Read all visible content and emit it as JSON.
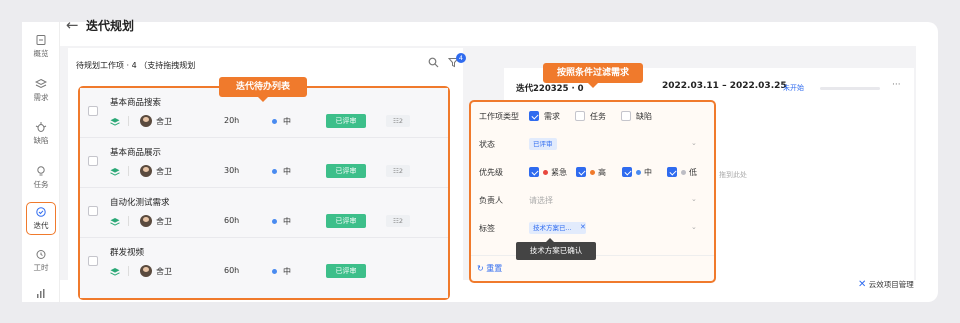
{
  "sidebar": {
    "items": [
      {
        "label": "概览",
        "icon": "overview-icon"
      },
      {
        "label": "需求",
        "icon": "layers-icon"
      },
      {
        "label": "缺陷",
        "icon": "bug-icon"
      },
      {
        "label": "任务",
        "icon": "bulb-icon"
      },
      {
        "label": "迭代",
        "icon": "iteration-icon",
        "active": true
      },
      {
        "label": "工时",
        "icon": "clock-icon"
      }
    ]
  },
  "header": {
    "back_icon": "←",
    "title": "迭代规划"
  },
  "left_panel": {
    "title": "待规划工作项 · 4 （支持拖拽规划",
    "filter_badge": "4"
  },
  "callouts": {
    "list": "迭代待办列表",
    "filter": "按照条件过滤需求"
  },
  "work_items": [
    {
      "name": "基本商品搜索",
      "owner": "舍卫",
      "hours": "20h",
      "priority": "中",
      "status": "已评审",
      "subtasks": "2"
    },
    {
      "name": "基本商品展示",
      "owner": "舍卫",
      "hours": "30h",
      "priority": "中",
      "status": "已评审",
      "subtasks": "2"
    },
    {
      "name": "自动化测试需求",
      "owner": "舍卫",
      "hours": "60h",
      "priority": "中",
      "status": "已评审",
      "subtasks": "2"
    },
    {
      "name": "群发视频",
      "owner": "舍卫",
      "hours": "60h",
      "priority": "中",
      "status": "已评审",
      "subtasks": ""
    }
  ],
  "sprint": {
    "name": "迭代220325 · 0",
    "dates": "2022.03.11 – 2022.03.25",
    "state": "未开始",
    "more": "···",
    "drop_hint": "拖到此处"
  },
  "filter": {
    "type_label": "工作项类型",
    "types": [
      {
        "label": "需求",
        "checked": true
      },
      {
        "label": "任务",
        "checked": false
      },
      {
        "label": "缺陷",
        "checked": false
      }
    ],
    "state_label": "状态",
    "state_value": "已评审",
    "priority_label": "优先级",
    "priorities": [
      {
        "label": "紧急",
        "color": "#e8473d",
        "checked": true
      },
      {
        "label": "高",
        "color": "#f07a2c",
        "checked": true
      },
      {
        "label": "中",
        "color": "#4a8bf0",
        "checked": true
      },
      {
        "label": "低",
        "color": "#bdbdc4",
        "checked": true
      }
    ],
    "assignee_label": "负责人",
    "assignee_placeholder": "请选择",
    "tag_label": "标签",
    "tag_value": "技术方案已...",
    "tooltip": "技术方案已确认",
    "reset": "重置"
  },
  "brand": "云效项目管理",
  "colors": {
    "accent": "#f07a2c",
    "primary": "#2f6bef",
    "reviewed": "#3dbf8a"
  }
}
